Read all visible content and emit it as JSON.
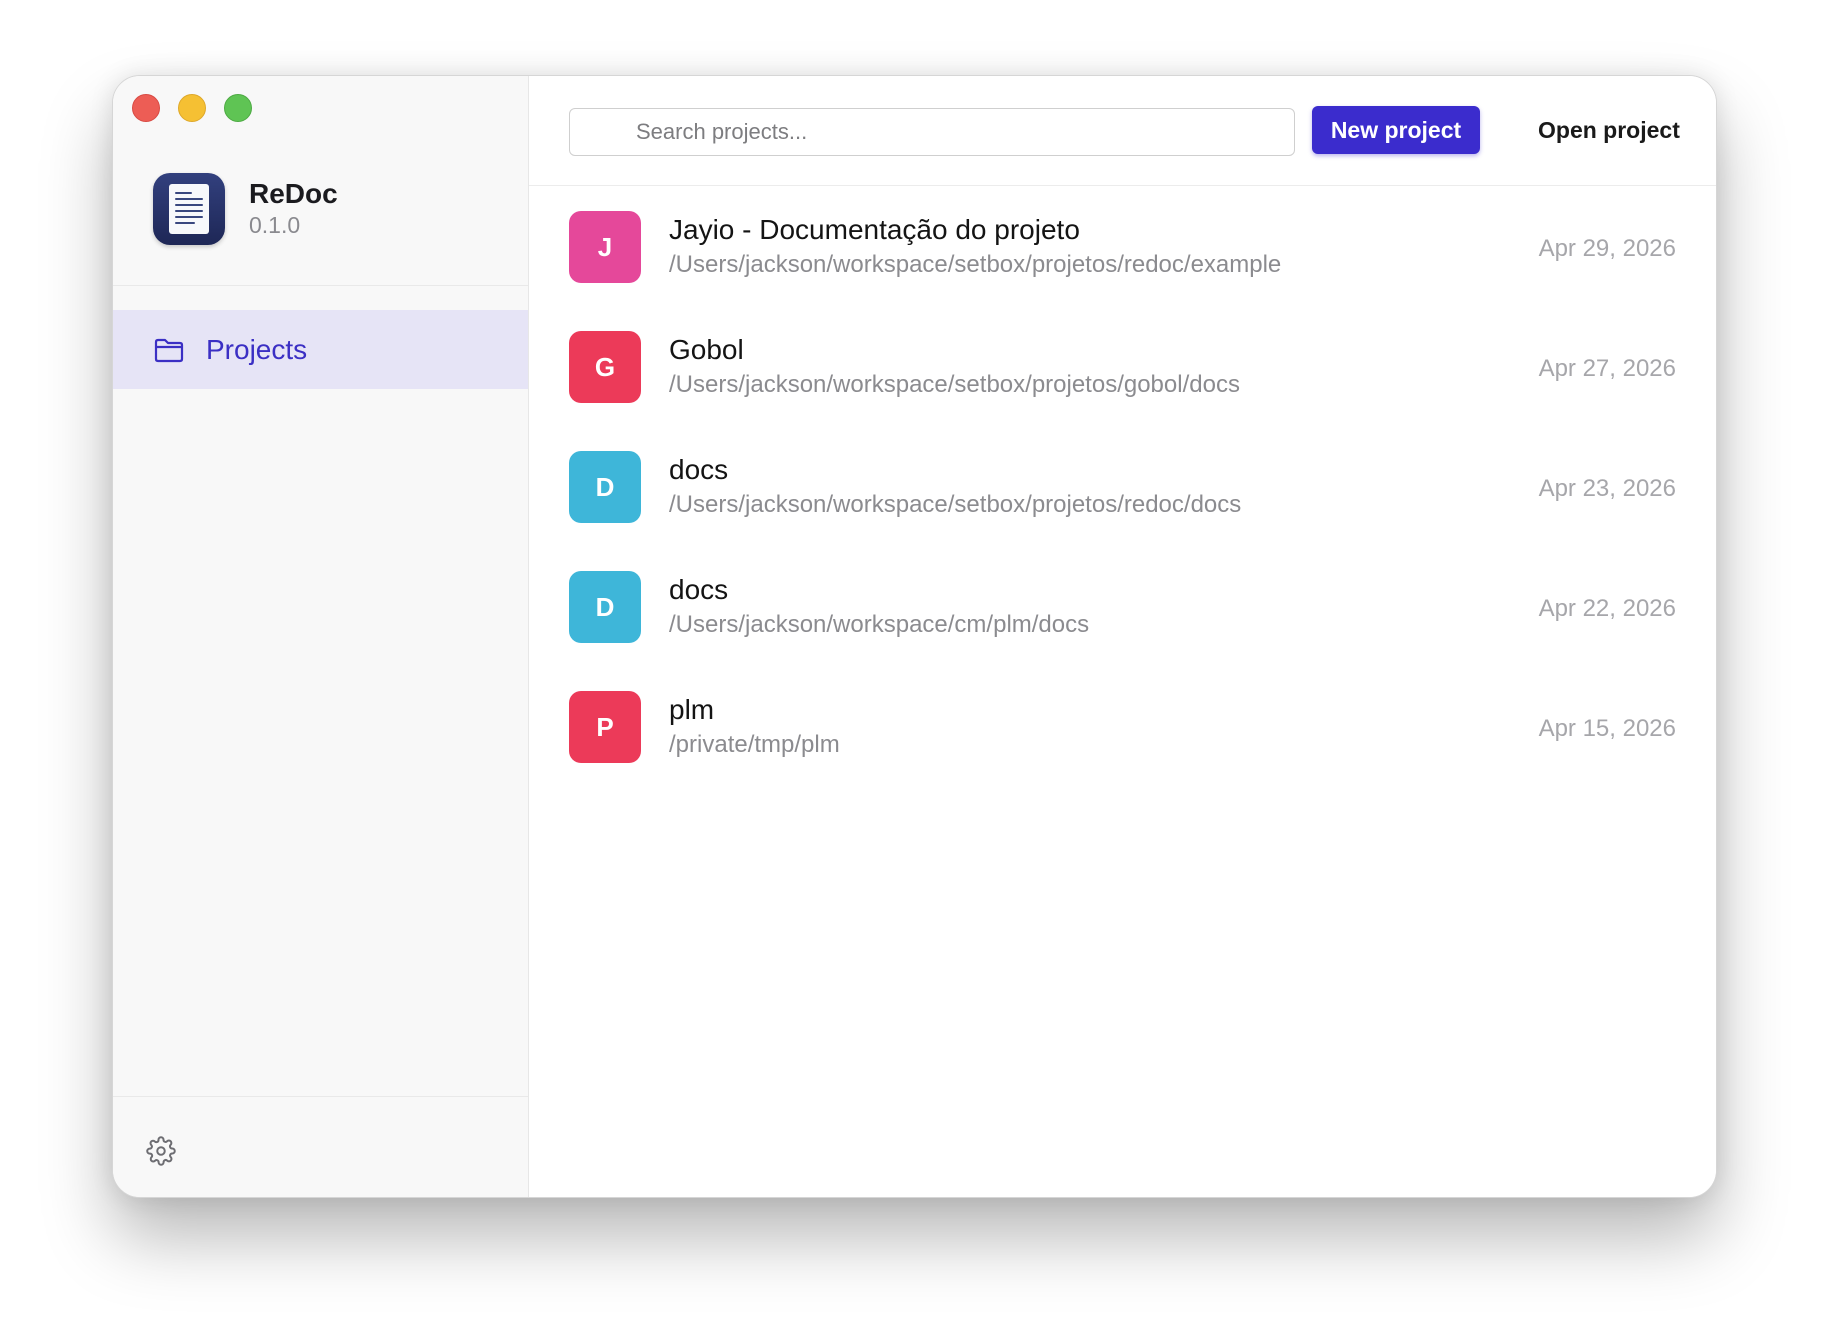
{
  "app": {
    "name": "ReDoc",
    "version": "0.1.0"
  },
  "sidebar": {
    "items": [
      {
        "label": "Projects",
        "icon": "folder-icon",
        "active": true
      }
    ],
    "settings_icon": "gear-icon"
  },
  "toolbar": {
    "search_placeholder": "Search projects...",
    "new_project_label": "New project",
    "open_project_label": "Open project"
  },
  "colors": {
    "accent": "#3b2ccd",
    "active_nav_bg": "#e6e4f6"
  },
  "projects": [
    {
      "initial": "J",
      "color": "#e5489a",
      "name": "Jayio - Documentação do projeto",
      "path": "/Users/jackson/workspace/setbox/projetos/redoc/example",
      "date": "Apr 29, 2026"
    },
    {
      "initial": "G",
      "color": "#ec3a59",
      "name": "Gobol",
      "path": "/Users/jackson/workspace/setbox/projetos/gobol/docs",
      "date": "Apr 27, 2026"
    },
    {
      "initial": "D",
      "color": "#3eb6d9",
      "name": "docs",
      "path": "/Users/jackson/workspace/setbox/projetos/redoc/docs",
      "date": "Apr 23, 2026"
    },
    {
      "initial": "D",
      "color": "#3eb6d9",
      "name": "docs",
      "path": "/Users/jackson/workspace/cm/plm/docs",
      "date": "Apr 22, 2026"
    },
    {
      "initial": "P",
      "color": "#ec3a59",
      "name": "plm",
      "path": "/private/tmp/plm",
      "date": "Apr 15, 2026"
    }
  ]
}
